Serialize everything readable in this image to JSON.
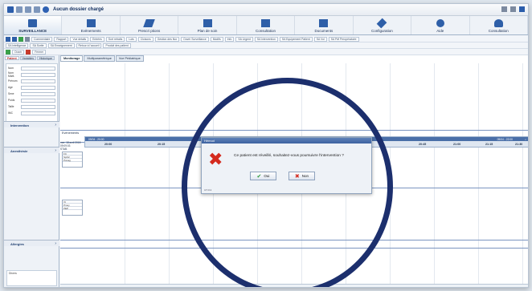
{
  "window": {
    "title": "Aucun dossier chargé"
  },
  "ribbon": {
    "tabs": [
      {
        "label": "SURVEILLANCE",
        "icon": "monitor-icon",
        "selected": true
      },
      {
        "label": "Evènements",
        "icon": "events-icon",
        "selected": false
      },
      {
        "label": "Prescri ptions",
        "icon": "syringe-icon",
        "selected": false
      },
      {
        "label": "Plan de soin",
        "icon": "care-plan-icon",
        "selected": false
      },
      {
        "label": "Consultation",
        "icon": "consultation-icon",
        "selected": false
      },
      {
        "label": "Documents",
        "icon": "documents-icon",
        "selected": false
      },
      {
        "label": "Configuration",
        "icon": "tools-icon",
        "selected": false
      },
      {
        "label": "Aide",
        "icon": "help-icon",
        "selected": false
      },
      {
        "label": "Consultation",
        "icon": "user-icon",
        "selected": false
      }
    ]
  },
  "toolbar1": {
    "buttons": [
      "Commentaire",
      "Rapport",
      "Vue details",
      "Entrées",
      "Sort retraits",
      "Lots",
      "Cloisons",
      "Gestion des flux",
      "Ouvrir Surveillance",
      "Modifs",
      "Info",
      "SA Urgent",
      "SA Intervention",
      "SA Equipement Patient",
      "SA Vol",
      "SA Pdf Peropératoire"
    ]
  },
  "toolbar2": {
    "buttons": [
      "SA Intelligence",
      "SA Sortie",
      "SA Enseignement",
      "Retour à l'accueil",
      "Produit des patient"
    ]
  },
  "toolbar3": {
    "buttons": [
      "Ouvrir",
      "Fermer"
    ]
  },
  "leftpanel": {
    "tabs": [
      "Patient",
      "Variables",
      "Historique"
    ],
    "fields": [
      {
        "label": "Nom",
        "value": ""
      },
      {
        "label": "Nom Marit.",
        "value": ""
      },
      {
        "label": "Prénom",
        "value": ""
      },
      {
        "label": "Age",
        "value": ""
      },
      {
        "label": "Sexe",
        "value": ""
      },
      {
        "label": "Poids",
        "value": ""
      },
      {
        "label": "Taille",
        "value": ""
      },
      {
        "label": "IMC",
        "value": ""
      }
    ],
    "sections": [
      "Intervention",
      "Anesthésie",
      "Allergies"
    ],
    "comment_label": "Divers"
  },
  "main": {
    "tabs": [
      "Monitorage",
      "Multiparamètrique",
      "Vue Pédiatrique"
    ],
    "events_label": "Evènements",
    "date_label": "mer. 18 avril 2018",
    "time_label": "09:09:03",
    "unit_label": "STAB.",
    "timeline_times": [
      "20:00",
      "20:15",
      "20:30",
      "20:45",
      "21:00",
      "21:15",
      "21:30"
    ],
    "timeline_bar_left": "09/04 - 20:00",
    "timeline_bar_right": "09/04 - 22:00",
    "small_table_headers": [
      "FC",
      "SpO2",
      "Ponag"
    ],
    "small_table2_headers": [
      "Vt",
      "Pmoy",
      "PEP"
    ]
  },
  "dialog": {
    "title": "Hémod",
    "icon": "error-x-icon",
    "message": "Ce patient est réveillé, souhaitez-vous poursuivre l'intervention ?",
    "yes_label": "Oui",
    "no_label": "Non",
    "version": "4.7.3.1"
  },
  "colors": {
    "accent": "#1c2f6d",
    "error": "#d42a1e",
    "ribbon_bg": "#eef2f7"
  }
}
